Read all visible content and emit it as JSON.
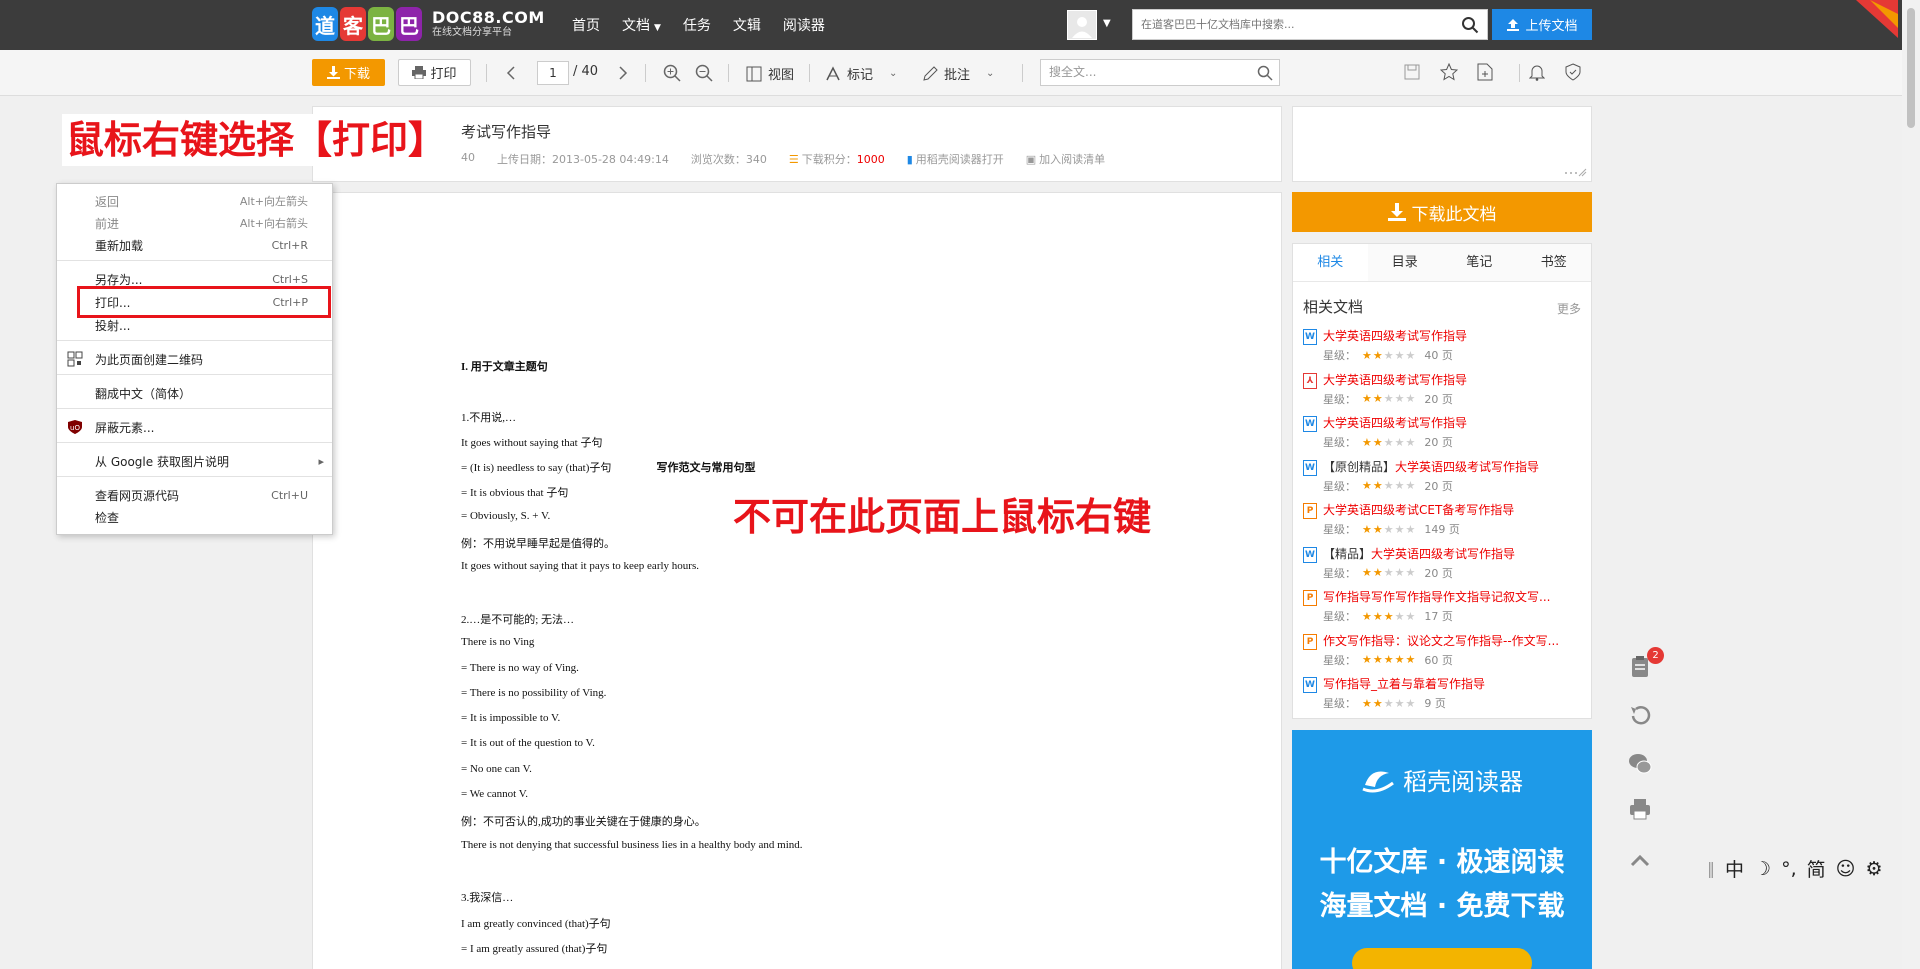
{
  "nav": {
    "logo_chars": [
      "道",
      "客",
      "巴",
      "巴"
    ],
    "logo_main": "DOC88.COM",
    "logo_sub": "在线文档分享平台",
    "links": [
      "首页",
      "文档",
      "任务",
      "文辑",
      "阅读器"
    ],
    "search_placeholder": "在道客巴巴十亿文档库中搜索...",
    "upload_label": "上传文档"
  },
  "toolbar": {
    "download_label": "下载",
    "print_label": "打印",
    "current_page": "1",
    "total_pages": "/ 40",
    "view_label": "视图",
    "mark_label": "标记",
    "annotate_label": "批注",
    "search_placeholder": "搜全文..."
  },
  "doc_header": {
    "title_partial": "考试写作指导",
    "pages_partial": "40",
    "upload_date": "上传日期：2013-05-28 04:49:14",
    "views": "浏览次数：340",
    "points_label": "下载积分：",
    "points_value": "1000",
    "open_with": "用稻壳阅读器打开",
    "add_reading_list": "加入阅读清单"
  },
  "annotations": {
    "top": "鼠标右键选择【打印】",
    "middle": "不可在此页面上鼠标右键"
  },
  "document": {
    "heading": "写作范文与常用句型",
    "lines": [
      "I.  用于文章主题句",
      "",
      "1.不用说,…",
      "It goes without saying that 子句",
      "= (It is) needless to say (that)子句",
      "= It is obvious that 子句",
      "= Obviously, S. + V.",
      "例：不用说早睡早起是值得的。",
      "It goes without saying that it pays to keep early hours.",
      "",
      "2.…是不可能的; 无法…",
      "There is no Ving",
      "= There is no way of Ving.",
      "= There is no possibility of Ving.",
      "= It is impossible to V.",
      "= It is out of the question to V.",
      "= No one can V.",
      "= We cannot V.",
      "例：不可否认的,成功的事业关键在于健康的身心。",
      "There is not denying that successful business lies in a healthy body and mind.",
      "",
      "3.我深信…",
      "I am greatly convinced (that)子句",
      "= I am greatly assured (that)子句"
    ]
  },
  "context_menu": {
    "items": [
      {
        "label": "返回",
        "shortcut": "Alt+向左箭头"
      },
      {
        "label": "前进",
        "shortcut": "Alt+向右箭头"
      },
      {
        "label": "重新加载",
        "shortcut": "Ctrl+R"
      },
      {
        "label": "另存为...",
        "shortcut": "Ctrl+S"
      },
      {
        "label": "打印...",
        "shortcut": "Ctrl+P"
      },
      {
        "label": "投射...",
        "shortcut": ""
      },
      {
        "label": "为此页面创建二维码",
        "shortcut": ""
      },
      {
        "label": "翻成中文（简体）",
        "shortcut": ""
      },
      {
        "label": "屏蔽元素...",
        "shortcut": ""
      },
      {
        "label": "从 Google 获取图片说明",
        "shortcut": "▸"
      },
      {
        "label": "查看网页源代码",
        "shortcut": "Ctrl+U"
      },
      {
        "label": "检查",
        "shortcut": ""
      }
    ]
  },
  "sidebar": {
    "download_doc_label": "下载此文档",
    "tabs": [
      "相关",
      "目录",
      "笔记",
      "书签"
    ],
    "related_heading": "相关文档",
    "more_label": "更多",
    "rating_label": "星级：",
    "related": [
      {
        "prefix": "",
        "title": "大学英语四级考试写作指导",
        "type": "W",
        "stars": 2,
        "pages": "40 页"
      },
      {
        "prefix": "",
        "title": "大学英语四级考试写作指导",
        "type": "PDF",
        "stars": 2,
        "pages": "20 页"
      },
      {
        "prefix": "",
        "title": "大学英语四级考试写作指导",
        "type": "W",
        "stars": 2,
        "pages": "20 页"
      },
      {
        "prefix": "【原创精品】",
        "title": "大学英语四级考试写作指导",
        "type": "W",
        "stars": 2,
        "pages": "20 页"
      },
      {
        "prefix": "",
        "title": "大学英语四级考试CET备考写作指导",
        "type": "P",
        "stars": 2,
        "pages": "149 页"
      },
      {
        "prefix": "【精品】",
        "title": "大学英语四级考试写作指导",
        "type": "W",
        "stars": 2,
        "pages": "20 页"
      },
      {
        "prefix": "",
        "title": "写作指导写作写作指导作文指导记叙文写...",
        "type": "P",
        "stars": 3,
        "pages": "17 页"
      },
      {
        "prefix": "",
        "title": "作文写作指导：议论文之写作指导--作文写...",
        "type": "P",
        "stars": 5,
        "pages": "60 页"
      },
      {
        "prefix": "",
        "title": "写作指导_立着与靠着写作指导",
        "type": "W",
        "stars": 2,
        "pages": "9 页"
      }
    ],
    "reader_ad": {
      "brand": "稻壳阅读器",
      "line1": "十亿文库 · 极速阅读",
      "line2": "海量文档 · 免费下载"
    }
  },
  "float_bar": {
    "badge_count": "2"
  },
  "ime": {
    "items": [
      "中",
      "☽",
      "°,",
      "简",
      "☺",
      "⚙"
    ]
  },
  "colors": {
    "accent_orange": "#f39800",
    "accent_blue": "#1e88e5",
    "annotation_red": "#e8141a",
    "nav_bg": "#3c3c3c"
  }
}
